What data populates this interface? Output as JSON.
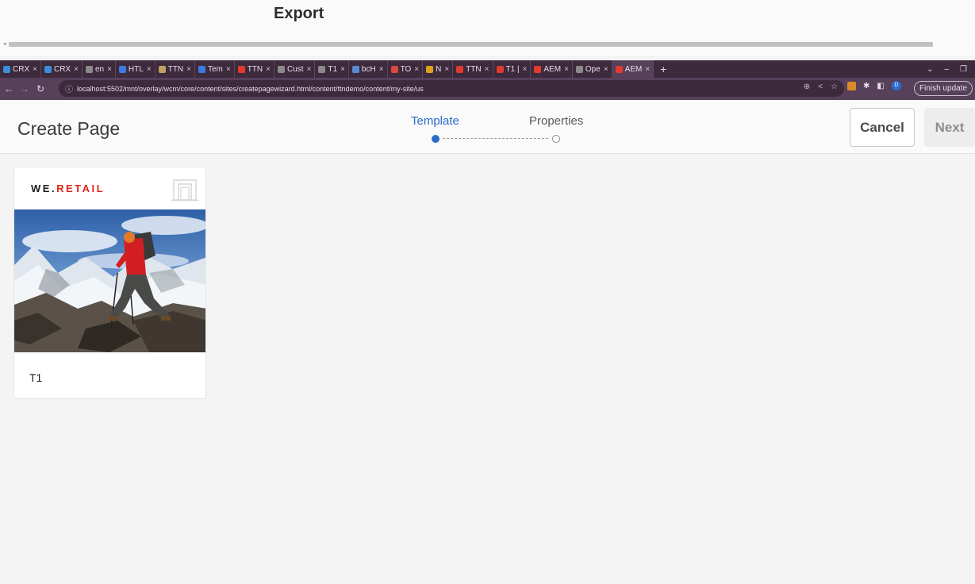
{
  "export": {
    "title": "Export"
  },
  "browser": {
    "tabs": [
      {
        "label": "CRX",
        "color": "#3b8fd6"
      },
      {
        "label": "CRX",
        "color": "#3b8fd6"
      },
      {
        "label": "en",
        "color": "#8a8a8a"
      },
      {
        "label": "HTL",
        "color": "#3d7be0"
      },
      {
        "label": "TTN",
        "color": "#c0a060"
      },
      {
        "label": "Tem",
        "color": "#3d7be0"
      },
      {
        "label": "TTN",
        "color": "#e23b2e"
      },
      {
        "label": "Cust",
        "color": "#8a8a8a"
      },
      {
        "label": "T1",
        "color": "#8a8a8a"
      },
      {
        "label": "bcH",
        "color": "#5a8ad0"
      },
      {
        "label": "TO",
        "color": "#d84a3a"
      },
      {
        "label": "N",
        "color": "#e0a020"
      },
      {
        "label": "TTN",
        "color": "#e23b2e"
      },
      {
        "label": "T1 |",
        "color": "#e23b2e"
      },
      {
        "label": "AEM",
        "color": "#e23b2e"
      },
      {
        "label": "Ope",
        "color": "#8a8a8a"
      },
      {
        "label": "AEM",
        "color": "#e23b2e"
      }
    ],
    "tab_close": "×",
    "new_tab": "+",
    "url": "localhost:5502/mnt/overlay/wcm/core/content/sites/createpagewizard.html/content/ttndemo/content/my-site/us",
    "finish_update": "Finish update",
    "profile_initial": "D"
  },
  "header": {
    "title": "Create Page",
    "steps": [
      {
        "label": "Template",
        "state": "active"
      },
      {
        "label": "Properties",
        "state": "pending"
      }
    ],
    "cancel_label": "Cancel",
    "next_label": "Next"
  },
  "templates": [
    {
      "brand_plain": "WE.",
      "brand_accent": "RETAIL",
      "brand_accent_color": "#e0261a",
      "title": "T1"
    }
  ]
}
